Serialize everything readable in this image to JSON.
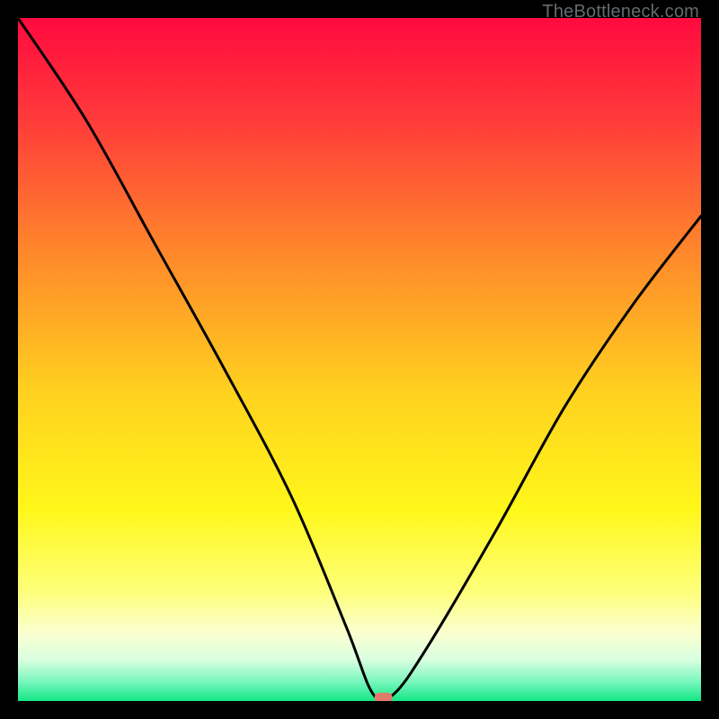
{
  "watermark": "TheBottleneck.com",
  "chart_data": {
    "type": "line",
    "title": "",
    "xlabel": "",
    "ylabel": "",
    "xlim": [
      0,
      100
    ],
    "ylim": [
      0,
      100
    ],
    "grid": false,
    "legend": false,
    "series": [
      {
        "name": "bottleneck-curve",
        "x": [
          0,
          10,
          20,
          30,
          40,
          48,
          52,
          55,
          60,
          70,
          80,
          90,
          100
        ],
        "values": [
          100,
          85,
          67,
          49,
          30,
          11,
          1,
          1,
          8,
          25,
          43,
          58,
          71
        ]
      }
    ],
    "marker": {
      "x": 53.5,
      "y": 0.5,
      "color": "#e07a6b"
    },
    "gradient_stops": [
      {
        "offset": 0.0,
        "color": "#ff0a3f"
      },
      {
        "offset": 0.15,
        "color": "#ff3b3a"
      },
      {
        "offset": 0.35,
        "color": "#ff8a2a"
      },
      {
        "offset": 0.55,
        "color": "#ffd21f"
      },
      {
        "offset": 0.72,
        "color": "#fff71a"
      },
      {
        "offset": 0.84,
        "color": "#fdff7a"
      },
      {
        "offset": 0.9,
        "color": "#fbffd0"
      },
      {
        "offset": 0.94,
        "color": "#d9ffe0"
      },
      {
        "offset": 0.97,
        "color": "#7ef7c0"
      },
      {
        "offset": 1.0,
        "color": "#14e785"
      }
    ]
  }
}
